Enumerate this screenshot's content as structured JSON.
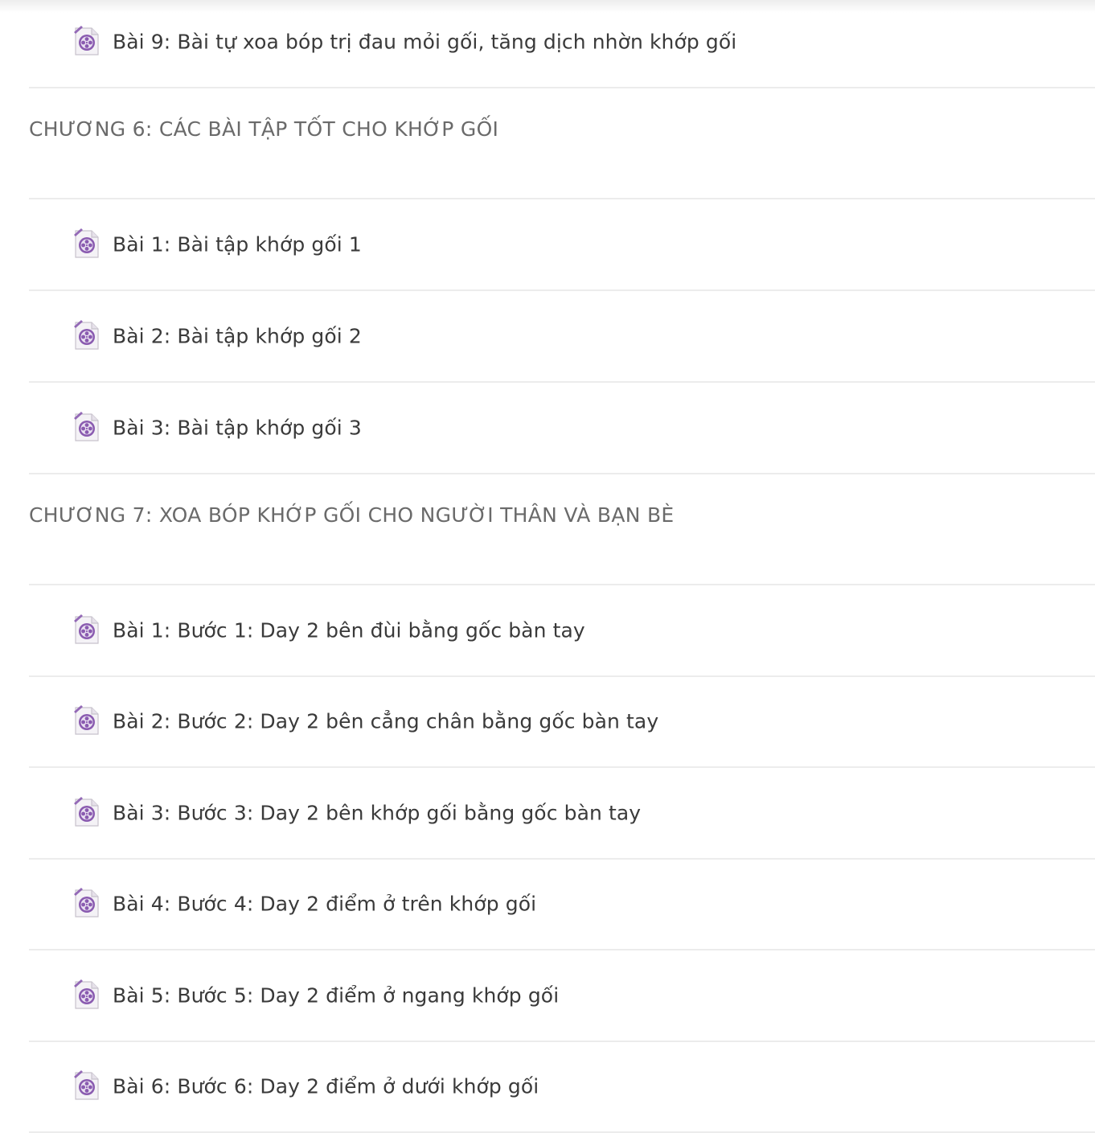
{
  "icon": {
    "name": "video-file-icon",
    "accent": "#8a5bb0"
  },
  "colors": {
    "lesson_text": "#3a3a3a",
    "chapter_text": "#6a6a6a",
    "divider": "#ececec"
  },
  "rows": [
    {
      "type": "lesson",
      "title": "Bài 9: Bài tự xoa bóp trị đau mỏi gối, tăng dịch nhờn khớp gối"
    },
    {
      "type": "chapter",
      "title": "CHƯƠNG 6: CÁC BÀI TẬP TỐT CHO KHỚP GỐI"
    },
    {
      "type": "lesson",
      "title": "Bài 1: Bài tập khớp gối 1"
    },
    {
      "type": "lesson",
      "title": "Bài 2: Bài tập khớp gối 2"
    },
    {
      "type": "lesson",
      "title": "Bài 3: Bài tập khớp gối 3"
    },
    {
      "type": "chapter",
      "title": "CHƯƠNG 7: XOA BÓP KHỚP GỐI CHO NGƯỜI THÂN VÀ BẠN BÈ"
    },
    {
      "type": "lesson",
      "title": "Bài 1: Bước 1: Day 2 bên đùi bằng gốc bàn tay"
    },
    {
      "type": "lesson",
      "title": "Bài 2: Bước 2: Day 2 bên cẳng chân bằng gốc bàn tay"
    },
    {
      "type": "lesson",
      "title": "Bài 3: Bước 3: Day 2 bên khớp gối bằng gốc bàn tay"
    },
    {
      "type": "lesson",
      "title": "Bài 4: Bước 4: Day 2 điểm ở trên khớp gối"
    },
    {
      "type": "lesson",
      "title": "Bài 5: Bước 5: Day 2 điểm ở ngang khớp gối"
    },
    {
      "type": "lesson",
      "title": "Bài 6: Bước 6: Day 2 điểm ở dưới khớp gối"
    }
  ]
}
